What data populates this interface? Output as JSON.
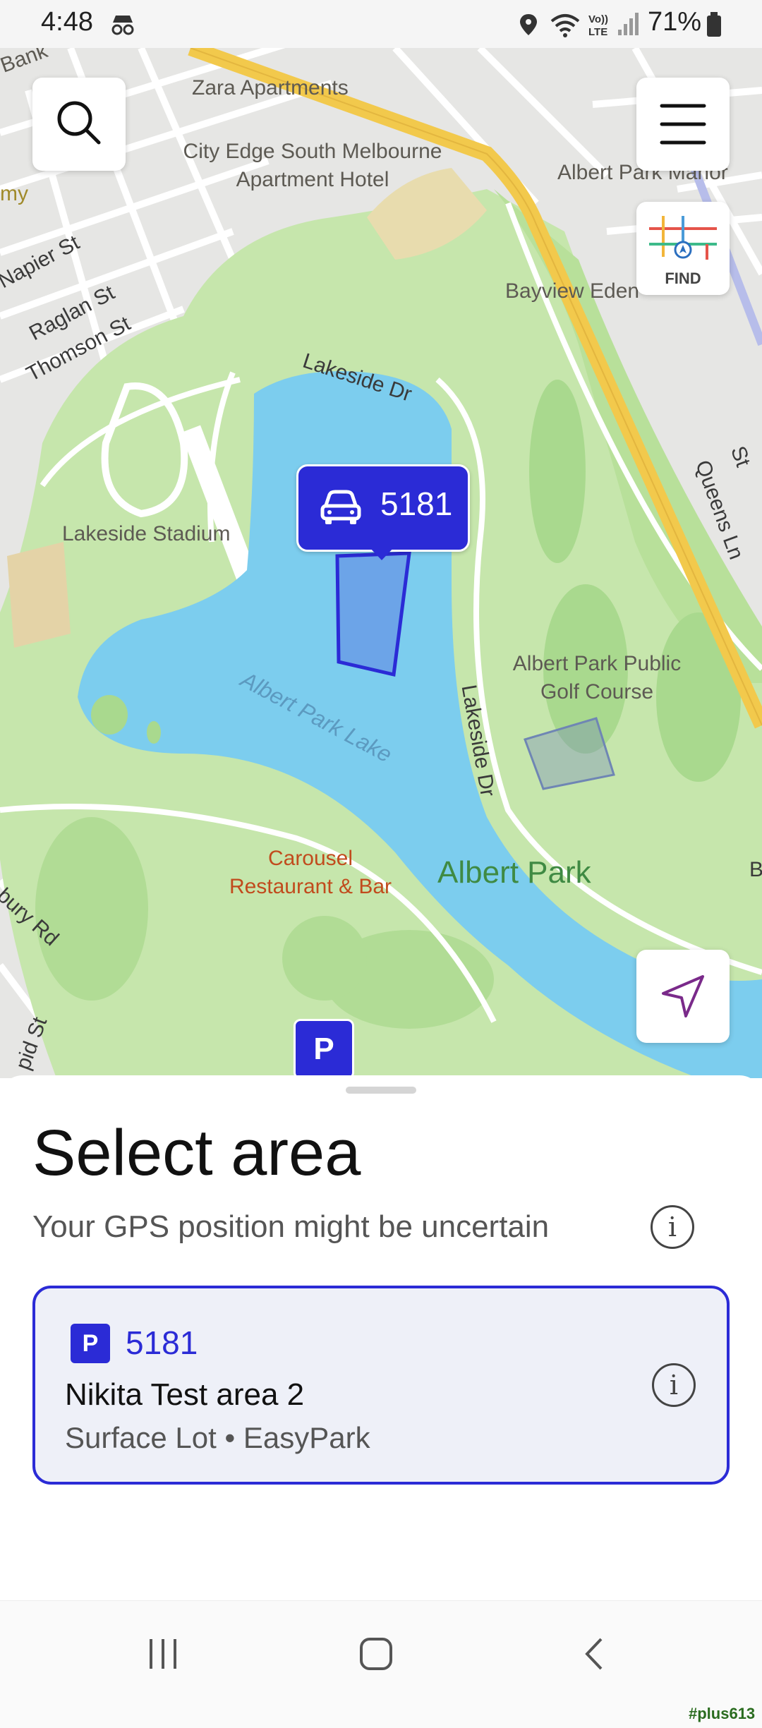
{
  "status_bar": {
    "time": "4:48",
    "battery": "71%",
    "icons": [
      "incognito-icon",
      "location-icon",
      "wifi-icon",
      "volte-icon",
      "signal-icon",
      "battery-icon"
    ]
  },
  "map": {
    "labels": {
      "zara": "Zara Apartments",
      "city_edge_1": "City Edge South Melbourne",
      "city_edge_2": "Apartment Hotel",
      "albert_park_manor": "Albert Park Manor",
      "bayview": "Bayview Eden",
      "lakeside_stadium": "Lakeside Stadium",
      "golf_1": "Albert Park Public",
      "golf_2": "Golf Course",
      "carousel_1": "Carousel",
      "carousel_2": "Restaurant & Bar",
      "albert_park": "Albert Park",
      "lake": "Albert Park Lake",
      "bank": "Bank",
      "my": "my"
    },
    "roads": {
      "napier": "Napier St",
      "raglan": "Raglan St",
      "thomson": "Thomson St",
      "lakeside_top": "Lakeside Dr",
      "lakeside_side": "Lakeside Dr",
      "queens": "Queens Ln",
      "bury": "bury Rd",
      "pid": "pid St",
      "st_right": "St",
      "b_right": "B"
    },
    "find_label": "FIND",
    "marker_code": "5181",
    "parking_pin_label": "P",
    "colors": {
      "water": "#7ccdee",
      "park": "#c6e6ac",
      "park_dark": "#a9d98e",
      "road_major": "#f2c94c",
      "accent": "#2b2bd6"
    }
  },
  "sheet": {
    "title": "Select area",
    "subtitle": "Your GPS position might be uncertain",
    "info_glyph": "i",
    "card": {
      "badge": "P",
      "code": "5181",
      "name": "Nikita Test area 2",
      "meta": "Surface Lot • EasyPark",
      "info_glyph": "i"
    }
  },
  "watermark": "#plus613"
}
